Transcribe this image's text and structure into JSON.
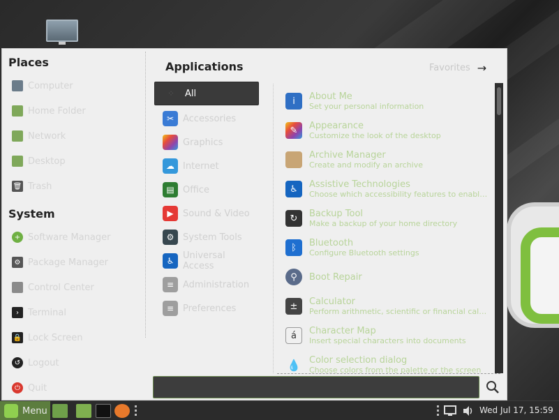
{
  "places": {
    "title": "Places",
    "items": [
      {
        "label": "Computer",
        "icon": "computer-icon"
      },
      {
        "label": "Home Folder",
        "icon": "home-folder-icon"
      },
      {
        "label": "Network",
        "icon": "network-icon"
      },
      {
        "label": "Desktop",
        "icon": "desktop-folder-icon"
      },
      {
        "label": "Trash",
        "icon": "trash-icon"
      }
    ]
  },
  "system": {
    "title": "System",
    "items": [
      {
        "label": "Software Manager",
        "icon": "software-manager-icon"
      },
      {
        "label": "Package Manager",
        "icon": "package-manager-icon"
      },
      {
        "label": "Control Center",
        "icon": "control-center-icon"
      },
      {
        "label": "Terminal",
        "icon": "terminal-icon"
      },
      {
        "label": "Lock Screen",
        "icon": "lock-icon"
      },
      {
        "label": "Logout",
        "icon": "logout-icon"
      },
      {
        "label": "Quit",
        "icon": "power-icon"
      }
    ]
  },
  "applications": {
    "title": "Applications",
    "favorites_label": "Favorites"
  },
  "categories": [
    {
      "label": "All",
      "icon": "all-icon",
      "color": "#3a3a3a"
    },
    {
      "label": "Accessories",
      "icon": "scissors-icon",
      "color": "#3a7bd5"
    },
    {
      "label": "Graphics",
      "icon": "graphics-icon",
      "color": "#c0392b"
    },
    {
      "label": "Internet",
      "icon": "cloud-icon",
      "color": "#3498db"
    },
    {
      "label": "Office",
      "icon": "office-icon",
      "color": "#2e7d32"
    },
    {
      "label": "Sound & Video",
      "icon": "play-icon",
      "color": "#e53935"
    },
    {
      "label": "System Tools",
      "icon": "system-tools-icon",
      "color": "#37474f"
    },
    {
      "label": "Universal Access",
      "icon": "accessibility-icon",
      "color": "#1565c0"
    },
    {
      "label": "Administration",
      "icon": "administration-icon",
      "color": "#9e9e9e"
    },
    {
      "label": "Preferences",
      "icon": "preferences-icon",
      "color": "#9e9e9e"
    }
  ],
  "apps": [
    {
      "name": "About Me",
      "desc": "Set your personal information",
      "icon": "info-icon",
      "color": "#2f6fc4"
    },
    {
      "name": "Appearance",
      "desc": "Customize the look of the desktop",
      "icon": "appearance-icon",
      "color": "#d43f8d"
    },
    {
      "name": "Archive Manager",
      "desc": "Create and modify an archive",
      "icon": "archive-icon",
      "color": "#c8a575"
    },
    {
      "name": "Assistive Technologies",
      "desc": "Choose which accessibility features to enable when you log in",
      "icon": "accessibility-icon",
      "color": "#1565c0"
    },
    {
      "name": "Backup Tool",
      "desc": "Make a backup of your home directory",
      "icon": "backup-icon",
      "color": "#333333"
    },
    {
      "name": "Bluetooth",
      "desc": "Configure Bluetooth settings",
      "icon": "bluetooth-icon",
      "color": "#1f6fd0"
    },
    {
      "name": "Boot Repair",
      "desc": "",
      "icon": "boot-repair-icon",
      "color": "#5a6b8a"
    },
    {
      "name": "Calculator",
      "desc": "Perform arithmetic, scientific or financial calculations",
      "icon": "calculator-icon",
      "color": "#444444"
    },
    {
      "name": "Character Map",
      "desc": "Insert special characters into documents",
      "icon": "character-map-icon",
      "color": "#f0f0f0"
    },
    {
      "name": "Color selection dialog",
      "desc": "Choose colors from the palette or the screen",
      "icon": "color-drop-icon",
      "color": "#222222"
    }
  ],
  "search": {
    "value": "",
    "placeholder": ""
  },
  "taskbar": {
    "menu_label": "Menu",
    "clock": "Wed Jul 17, 15:59"
  }
}
